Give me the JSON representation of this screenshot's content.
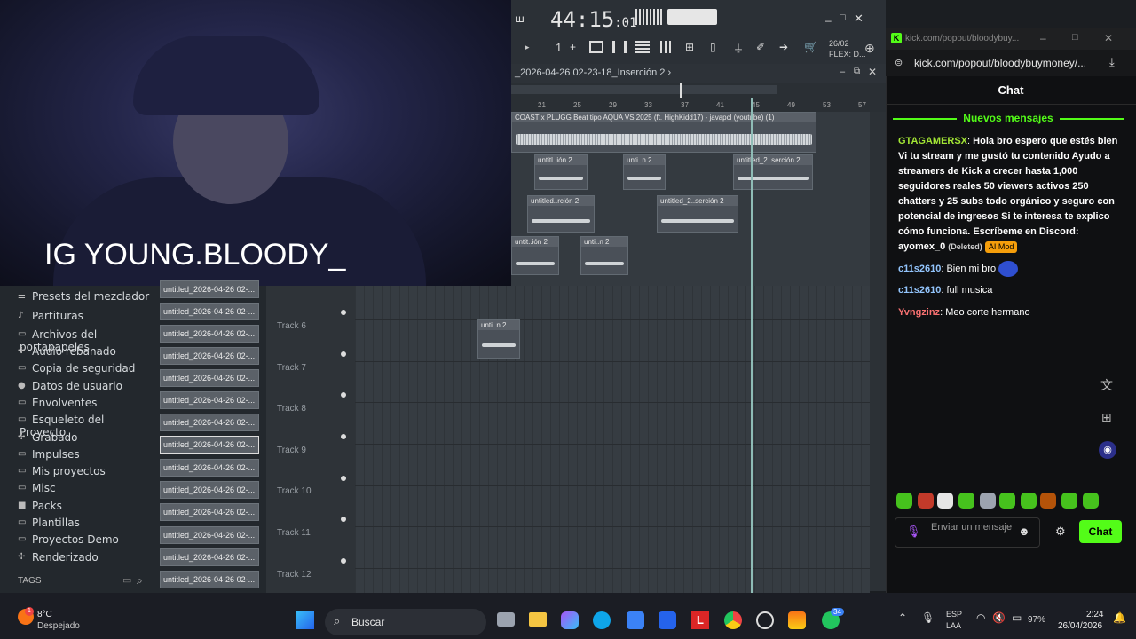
{
  "overlay": {
    "text": "IG YOUNG.BLOODY_"
  },
  "fl": {
    "time_main": "44:15",
    "time_sub": ":01",
    "pattern_num": "1",
    "date_small": "26/02",
    "flex_label": "FLEX: D...",
    "playlist_title": "_2026-04-26 02-23-18_Inserción 2 ›",
    "ruler": [
      "21",
      "25",
      "29",
      "33",
      "37",
      "41",
      "45",
      "49",
      "53",
      "57"
    ],
    "main_clip": "COAST x PLUGG  Beat tipo AQUA VS 2025 (ft. HighKidd17) - javapcl (youtube) (1)",
    "clips": [
      "untitl..ión 2",
      "unti..n 2",
      "untitled_2..serción 2",
      "untitled..rción 2",
      "untitled_2..serción 2",
      "untit..ión 2",
      "unti..n 2",
      "unti..n 2"
    ],
    "browser_items": [
      {
        "label": "Presets del mezclador",
        "icon": "mixer-icon"
      },
      {
        "label": "Partituras",
        "icon": "score-icon"
      },
      {
        "label": "Archivos del portapapeles",
        "icon": "folder-icon"
      },
      {
        "label": "Audio rebanado",
        "icon": "slice-icon"
      },
      {
        "label": "Copia de seguridad",
        "icon": "backup-icon"
      },
      {
        "label": "Datos de usuario",
        "icon": "user-icon"
      },
      {
        "label": "Envolventes",
        "icon": "folder-icon"
      },
      {
        "label": "Esqueleto del Proyecto",
        "icon": "folder-icon"
      },
      {
        "label": "Grabado",
        "icon": "record-icon"
      },
      {
        "label": "Impulses",
        "icon": "folder-icon"
      },
      {
        "label": "Mis proyectos",
        "icon": "folder-icon"
      },
      {
        "label": "Misc",
        "icon": "folder-icon"
      },
      {
        "label": "Packs",
        "icon": "packs-icon"
      },
      {
        "label": "Plantillas",
        "icon": "folder-icon"
      },
      {
        "label": "Proyectos Demo",
        "icon": "folder-icon"
      },
      {
        "label": "Renderizado",
        "icon": "render-icon"
      }
    ],
    "tags_label": "TAGS",
    "files": [
      "untitled_2026-04-26 02-...",
      "untitled_2026-04-26 02-...",
      "untitled_2026-04-26 02-...",
      "untitled_2026-04-26 02-...",
      "untitled_2026-04-26 02-...",
      "untitled_2026-04-26 02-...",
      "untitled_2026-04-26 02-...",
      "untitled_2026-04-26 02-...",
      "untitled_2026-04-26 02-...",
      "untitled_2026-04-26 02-...",
      "untitled_2026-04-26 02-...",
      "untitled_2026-04-26 02-...",
      "untitled_2026-04-26 02-...",
      "untitled_2026-04-26 02-..."
    ],
    "tracks": [
      "Track 6",
      "Track 7",
      "Track 8",
      "Track 9",
      "Track 10",
      "Track 11",
      "Track 12"
    ]
  },
  "chat": {
    "tab_url": "kick.com/popout/bloodybuy...",
    "url": "kick.com/popout/bloodybuymoney/...",
    "title": "Chat",
    "new_messages": "Nuevos mensajes",
    "messages": [
      {
        "user": "GTAGAMERSX",
        "color": "#a3e635",
        "text": "Hola bro espero que estés bien Vi tu stream y me gustó tu contenido Ayudo a streamers de Kick a crecer hasta 1,000 seguidores reales 50 viewers activos 250 chatters y 25 subs todo orgánico y seguro con potencial de ingresos Si te interesa te explico cómo funciona. Escríbeme en Discord: ayomex_0",
        "deleted": "(Deleted)",
        "badge": "AI Mod"
      },
      {
        "user": "c11s2610",
        "color": "#93c5fd",
        "text": "Bien mi bro"
      },
      {
        "user": "c11s2610",
        "color": "#93c5fd",
        "text": "full musica"
      },
      {
        "user": "Yvngzinz",
        "color": "#f87171",
        "text": "Meo corte hermano"
      }
    ],
    "input_placeholder": "Enviar un mensaje",
    "send_label": "Chat"
  },
  "taskbar": {
    "weather_temp": "8°C",
    "weather_desc": "Despejado",
    "search_label": "Buscar",
    "lang1": "ESP",
    "lang2": "LAA",
    "battery": "97%",
    "time": "2:24",
    "date": "26/04/2026",
    "badge_count": "34"
  }
}
